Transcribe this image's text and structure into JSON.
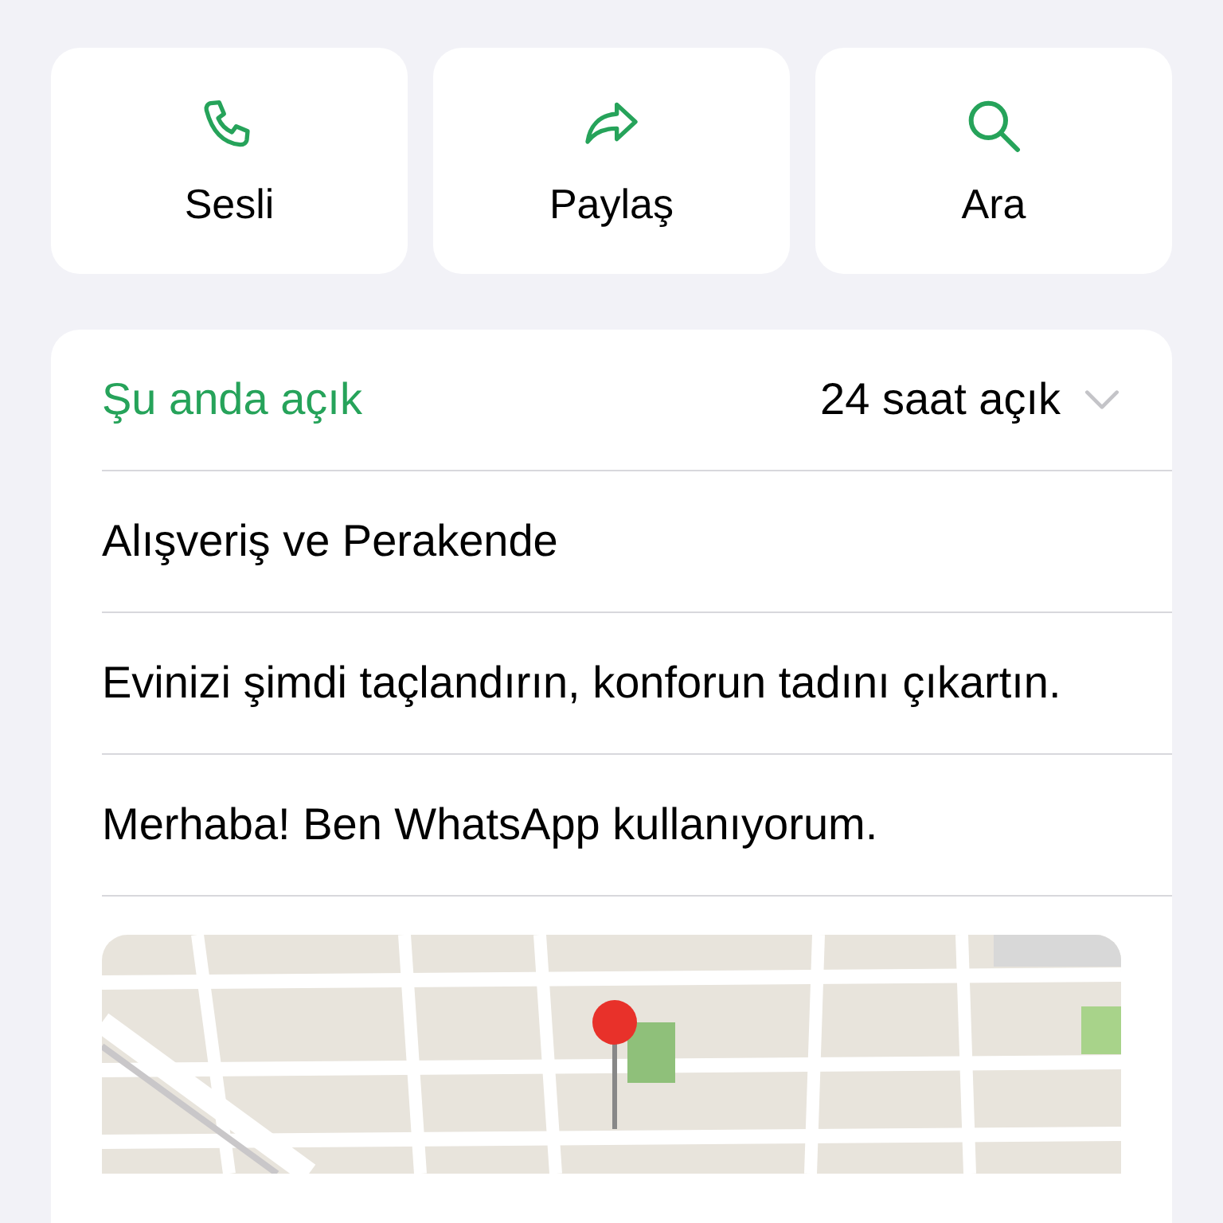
{
  "actions": [
    {
      "kind": "phone",
      "label": "Sesli"
    },
    {
      "kind": "share",
      "label": "Paylaş"
    },
    {
      "kind": "search",
      "label": "Ara"
    }
  ],
  "hours": {
    "status": "Şu anda açık",
    "summary": "24 saat açık",
    "expanded": false
  },
  "details": [
    "Alışveriş ve Perakende",
    "Evinizi şimdi taçlandırın, konforun tadını çıkartın.",
    "Merhaba! Ben WhatsApp kullanıyorum."
  ]
}
